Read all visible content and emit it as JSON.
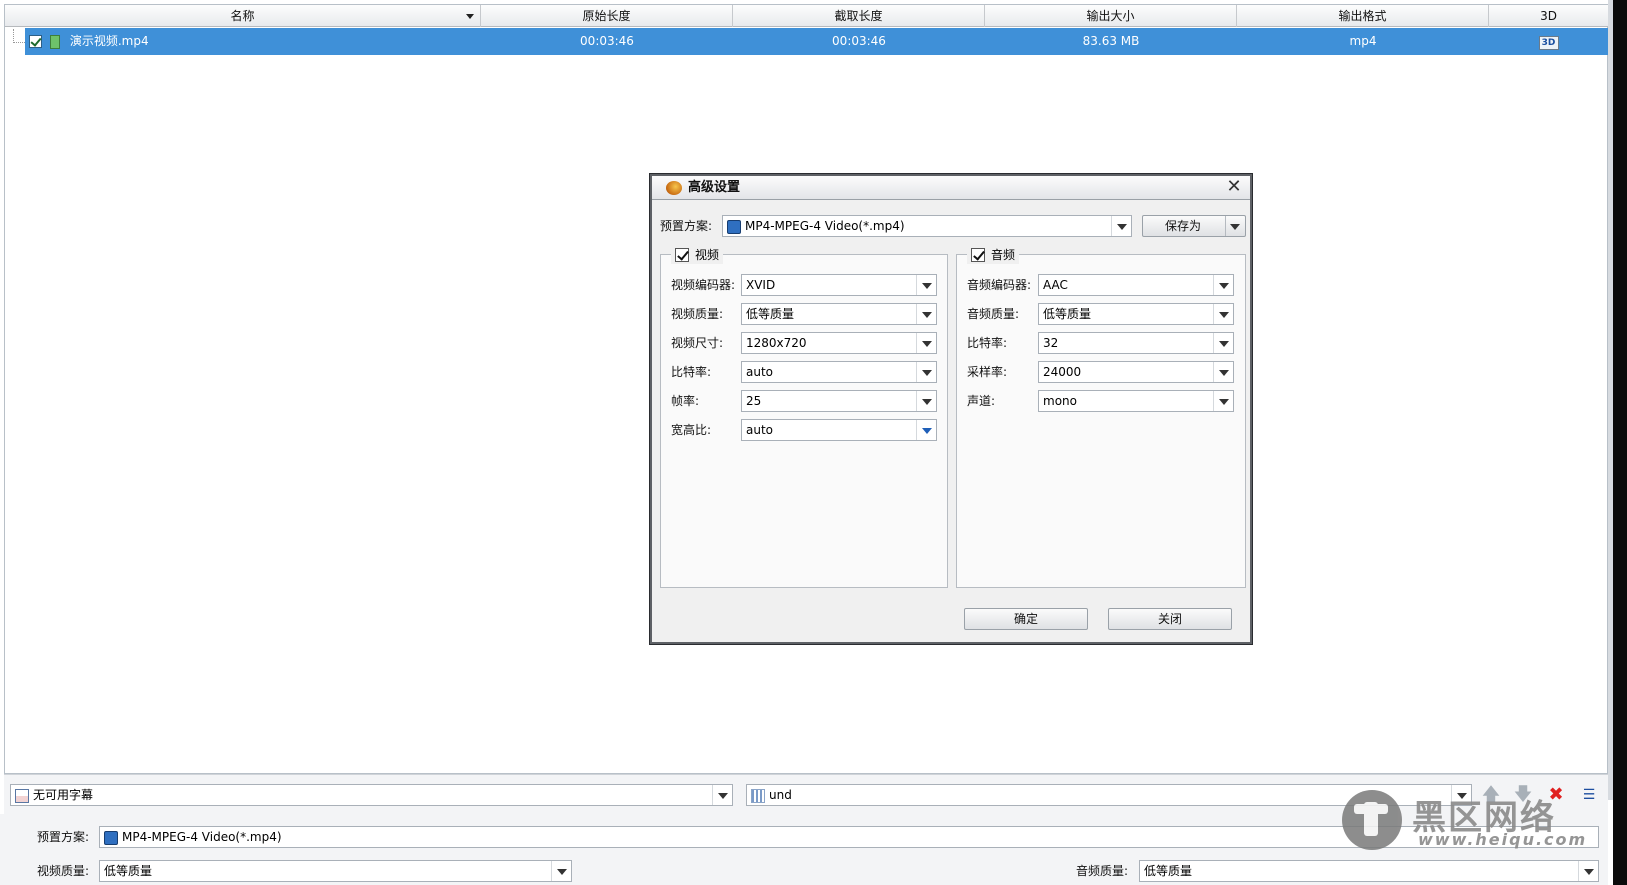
{
  "file_list": {
    "columns": [
      "名称",
      "原始长度",
      "截取长度",
      "输出大小",
      "输出格式",
      "3D"
    ],
    "rows": [
      {
        "name": "演示视频.mp4",
        "original_length": "00:03:46",
        "clip_length": "00:03:46",
        "output_size": "83.63 MB",
        "output_format": "mp4",
        "badge_3d": "3D"
      }
    ]
  },
  "trackbar": {
    "subtitle_value": "无可用字幕",
    "audio_track_value": "und"
  },
  "bottom": {
    "preset_label": "预置方案:",
    "preset_value": "MP4-MPEG-4 Video(*.mp4)",
    "video_quality_label": "视频质量:",
    "video_quality_value": "低等质量",
    "audio_quality_label": "音频质量:",
    "audio_quality_value": "低等质量"
  },
  "dialog": {
    "title": "高级设置",
    "close_glyph": "✕",
    "preset_label": "预置方案:",
    "preset_value": "MP4-MPEG-4 Video(*.mp4)",
    "save_as_label": "保存为",
    "video_group": {
      "label": "视频",
      "fields": [
        {
          "label": "视频编码器:",
          "value": "XVID"
        },
        {
          "label": "视频质量:",
          "value": "低等质量"
        },
        {
          "label": "视频尺寸:",
          "value": "1280x720"
        },
        {
          "label": "比特率:",
          "value": "auto"
        },
        {
          "label": "帧率:",
          "value": "25"
        },
        {
          "label": "宽高比:",
          "value": "auto"
        }
      ]
    },
    "audio_group": {
      "label": "音频",
      "fields": [
        {
          "label": "音频编码器:",
          "value": "AAC"
        },
        {
          "label": "音频质量:",
          "value": "低等质量"
        },
        {
          "label": "比特率:",
          "value": "32"
        },
        {
          "label": "采样率:",
          "value": "24000"
        },
        {
          "label": "声道:",
          "value": "mono"
        }
      ]
    },
    "ok_label": "确定",
    "close_label": "关闭"
  },
  "watermark": {
    "name": "黑区网络",
    "url": "www.heiqu.com"
  },
  "icons": {
    "close": "close-icon",
    "sort": "sort-down-icon",
    "move_up": "arrow-up-icon",
    "move_down": "arrow-down-icon",
    "delete": "delete-x-icon",
    "list_settings": "list-icon"
  }
}
